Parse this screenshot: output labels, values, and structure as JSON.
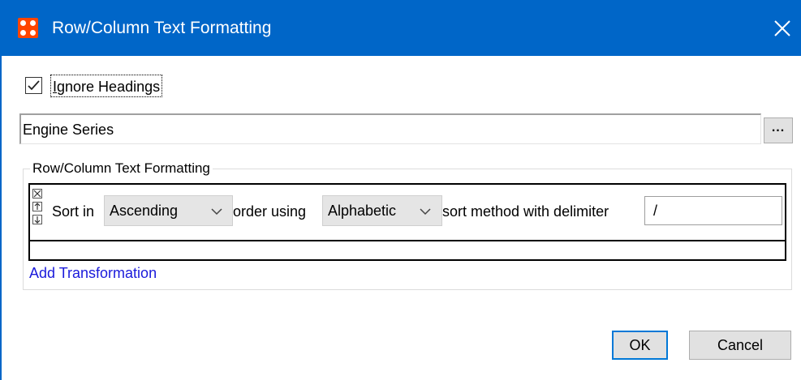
{
  "window": {
    "title": "Row/Column Text Formatting",
    "icon": "app-grid-icon",
    "close_icon": "close-icon",
    "titlebar_color": "#0066c8",
    "icon_color": "#ff4500"
  },
  "ignore_headings": {
    "label_prefix": "",
    "label_mnemonic": "I",
    "label_rest": "gnore Headings",
    "checked": true
  },
  "series_field": {
    "value": "Engine Series",
    "browse_label": "..."
  },
  "group": {
    "legend": "Row/Column Text Formatting",
    "transformation": {
      "sort_in_label": "Sort in",
      "order_value": "Ascending",
      "order_using_label": "order using",
      "method_value": "Alphabetic",
      "method_suffix_label": "sort method with delimiter",
      "delimiter_value": "/",
      "controls": [
        "remove-icon",
        "move-up-icon",
        "move-down-icon"
      ]
    },
    "add_link": "Add Transformation",
    "link_color": "#1a1adb"
  },
  "buttons": {
    "ok": "OK",
    "cancel": "Cancel"
  }
}
